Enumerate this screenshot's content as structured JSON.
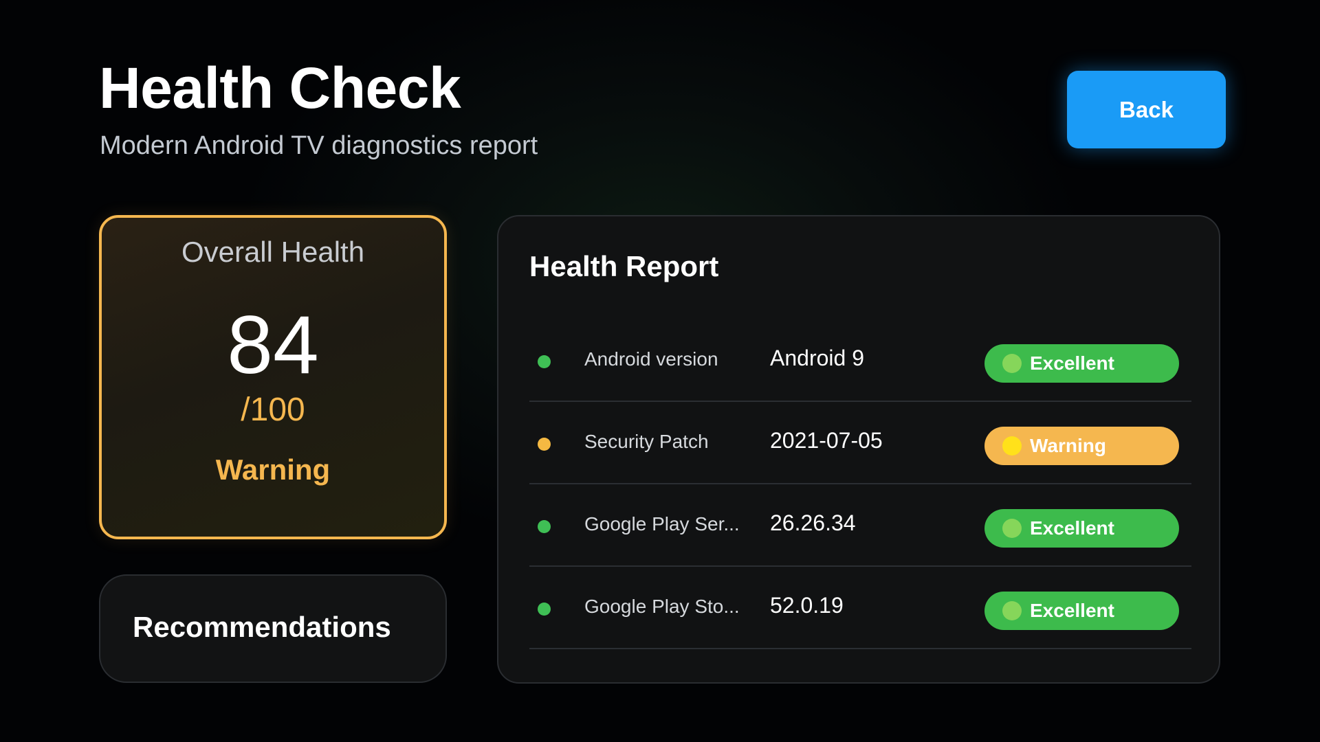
{
  "header": {
    "title": "Health Check",
    "subtitle": "Modern Android TV diagnostics report",
    "back_label": "Back"
  },
  "overall": {
    "label": "Overall Health",
    "score": "84",
    "max": "/100",
    "status": "Warning"
  },
  "recommendations": {
    "title": "Recommendations"
  },
  "report": {
    "title": "Health Report",
    "rows": [
      {
        "name": "Android version",
        "value": "Android 9",
        "status": "Excellent",
        "level": "ok"
      },
      {
        "name": "Security Patch",
        "value": "2021-07-05",
        "status": "Warning",
        "level": "warn"
      },
      {
        "name": "Google Play Ser...",
        "value": "26.26.34",
        "status": "Excellent",
        "level": "ok"
      },
      {
        "name": "Google Play Sto...",
        "value": "52.0.19",
        "status": "Excellent",
        "level": "ok"
      }
    ]
  },
  "colors": {
    "accent_blue": "#1a9bf6",
    "ok_green": "#3dbb4c",
    "ok_dot": "#3fbf55",
    "warn_amber": "#f5b74f",
    "warn_dot": "#f5b942",
    "ok_icon": "#86d65a",
    "warn_icon": "#ffe11a"
  }
}
